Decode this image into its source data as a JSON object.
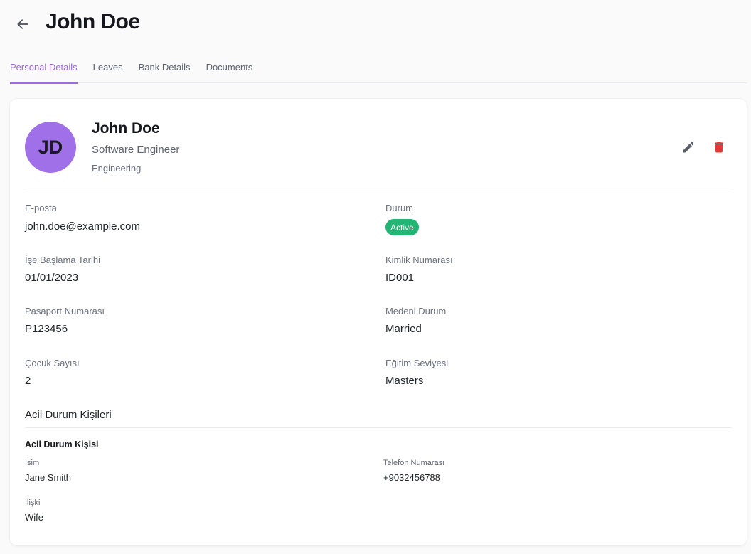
{
  "header": {
    "title": "John Doe"
  },
  "tabs": [
    {
      "label": "Personal Details",
      "active": true
    },
    {
      "label": "Leaves",
      "active": false
    },
    {
      "label": "Bank Details",
      "active": false
    },
    {
      "label": "Documents",
      "active": false
    }
  ],
  "profile": {
    "initials": "JD",
    "name": "John Doe",
    "role": "Software Engineer",
    "department": "Engineering",
    "avatar_color": "#a070e8"
  },
  "actions": {
    "edit_icon": "pencil-icon",
    "delete_icon": "trash-icon",
    "delete_color": "#e53935"
  },
  "details": {
    "email": {
      "label": "E-posta",
      "value": "john.doe@example.com"
    },
    "status": {
      "label": "Durum",
      "value": "Active",
      "color": "#22b573"
    },
    "start_date": {
      "label": "İşe Başlama Tarihi",
      "value": "01/01/2023"
    },
    "id_number": {
      "label": "Kimlik Numarası",
      "value": "ID001"
    },
    "passport": {
      "label": "Pasaport Numarası",
      "value": "P123456"
    },
    "marital": {
      "label": "Medeni Durum",
      "value": "Married"
    },
    "children": {
      "label": "Çocuk Sayısı",
      "value": "2"
    },
    "education": {
      "label": "Eğitim Seviyesi",
      "value": "Masters"
    }
  },
  "emergency": {
    "section_title": "Acil Durum Kişileri",
    "contact_title": "Acil Durum Kişisi",
    "name": {
      "label": "İsim",
      "value": "Jane Smith"
    },
    "phone": {
      "label": "Telefon Numarası",
      "value": "+9032456788"
    },
    "relation": {
      "label": "İlişki",
      "value": "Wife"
    }
  }
}
